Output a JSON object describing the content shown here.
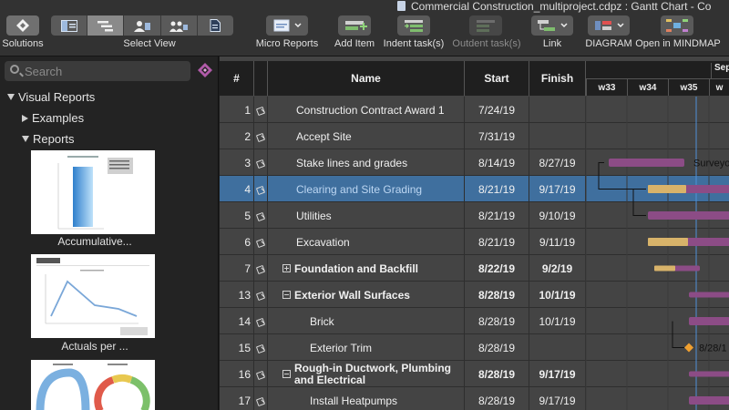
{
  "window": {
    "title": "Commercial Construction_multiproject.cdpz : Gantt Chart - Co"
  },
  "toolbar": {
    "solutions_label": "Solutions",
    "select_view_label": "Select View",
    "micro_reports_label": "Micro Reports",
    "add_item_label": "Add Item",
    "indent_label": "Indent task(s)",
    "outdent_label": "Outdent task(s)",
    "link_label": "Link",
    "diagram_label": "DIAGRAM",
    "mindmap_label": "Open in MINDMAP"
  },
  "sidebar": {
    "search_placeholder": "Search",
    "visual_reports_label": "Visual Reports",
    "examples_label": "Examples",
    "reports_label": "Reports",
    "thumbnails": [
      {
        "caption": "Accumulative..."
      },
      {
        "caption": "Actuals per ..."
      },
      {
        "caption": ""
      }
    ]
  },
  "grid": {
    "columns": {
      "num": "#",
      "name": "Name",
      "start": "Start",
      "finish": "Finish"
    },
    "timeline": {
      "weeks": [
        "w33",
        "w34",
        "w35",
        "w"
      ],
      "month": "Sep"
    },
    "rows": [
      {
        "num": "1",
        "name": "Construction Contract Award 1",
        "start": "7/24/19",
        "finish": "",
        "bold": false,
        "indent": 0,
        "expander": ""
      },
      {
        "num": "2",
        "name": "Accept Site",
        "start": "7/31/19",
        "finish": "",
        "bold": false,
        "indent": 0,
        "expander": ""
      },
      {
        "num": "3",
        "name": "Stake lines and grades",
        "start": "8/14/19",
        "finish": "8/27/19",
        "bold": false,
        "indent": 0,
        "expander": ""
      },
      {
        "num": "4",
        "name": "Clearing and Site Grading",
        "start": "8/21/19",
        "finish": "9/17/19",
        "bold": false,
        "indent": 0,
        "expander": "",
        "selected": true
      },
      {
        "num": "5",
        "name": "Utilities",
        "start": "8/21/19",
        "finish": "9/10/19",
        "bold": false,
        "indent": 0,
        "expander": ""
      },
      {
        "num": "6",
        "name": "Excavation",
        "start": "8/21/19",
        "finish": "9/11/19",
        "bold": false,
        "indent": 0,
        "expander": ""
      },
      {
        "num": "7",
        "name": "Foundation and Backfill",
        "start": "8/22/19",
        "finish": "9/2/19",
        "bold": true,
        "indent": 0,
        "expander": "plus"
      },
      {
        "num": "13",
        "name": "Exterior Wall Surfaces",
        "start": "8/28/19",
        "finish": "10/1/19",
        "bold": true,
        "indent": 0,
        "expander": "minus"
      },
      {
        "num": "14",
        "name": "Brick",
        "start": "8/28/19",
        "finish": "10/1/19",
        "bold": false,
        "indent": 1,
        "expander": ""
      },
      {
        "num": "15",
        "name": "Exterior Trim",
        "start": "8/28/19",
        "finish": "",
        "bold": false,
        "indent": 1,
        "expander": ""
      },
      {
        "num": "16",
        "name": "Rough-in Ductwork, Plumbing and Electrical",
        "start": "8/28/19",
        "finish": "9/17/19",
        "bold": true,
        "indent": 0,
        "expander": "minus",
        "wrap": true
      },
      {
        "num": "17",
        "name": "Install Heatpumps",
        "start": "8/28/19",
        "finish": "9/17/19",
        "bold": false,
        "indent": 1,
        "expander": ""
      }
    ],
    "bar_labels": [
      {
        "row": 2,
        "text": "Surveyo"
      },
      {
        "row": 9,
        "text": "8/28/1"
      }
    ]
  },
  "colors": {
    "bar_purple": "#8c4c86",
    "bar_gold": "#d8b36a",
    "selection": "#3f6f9e",
    "today_line": "#4f90d8"
  }
}
